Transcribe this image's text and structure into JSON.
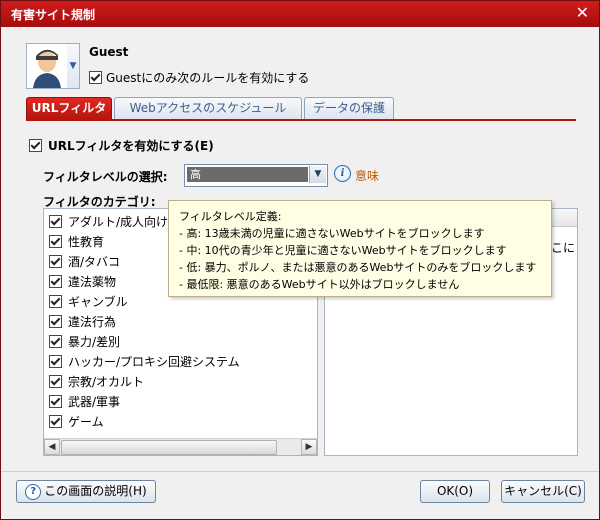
{
  "window": {
    "title": "有害サイト規制",
    "close_glyph": "✕"
  },
  "user": {
    "name": "Guest",
    "rule_label": "Guestにのみ次のルールを有効にする",
    "rule_checked": true,
    "avatar_icon": "user-avatar-icon"
  },
  "tabs": [
    "URLフィルタ",
    "Webアクセスのスケジュール",
    "データの保護"
  ],
  "active_tab": "URLフィルタ",
  "url_filter": {
    "enable_label": "URLフィルタを有効にする(E)",
    "enabled": true,
    "level_label": "フィルタレベルの選択:",
    "level_value": "高",
    "meaning_link": "意味",
    "category_label": "フィルタのカテゴリ:",
    "categories": [
      "アダルト/成人向け",
      "性教育",
      "酒/タバコ",
      "違法薬物",
      "ギャンブル",
      "違法行為",
      "暴力/差別",
      "ハッカー/プロキシ回避システム",
      "宗教/オカルト",
      "武器/軍事",
      "ゲーム"
    ],
    "right_panel_partial_text": "こに"
  },
  "tooltip": {
    "lines": [
      "フィルタレベル定義:",
      "- 高: 13歳未満の児童に適さないWebサイトをブロックします",
      "- 中: 10代の青少年と児童に適さないWebサイトをブロックします",
      "- 低: 暴力、ポルノ、または悪意のあるWebサイトのみをブロックします",
      "- 最低限: 悪意のあるWebサイト以外はブロックしません"
    ]
  },
  "buttons": {
    "help": "この画面の説明(H)",
    "ok": "OK(O)",
    "cancel": "キャンセル(C)"
  },
  "colors": {
    "title_bar": "#b41610",
    "active_tab": "#c81e17",
    "link": "#c05a00",
    "tooltip_bg": "#fffde3"
  }
}
